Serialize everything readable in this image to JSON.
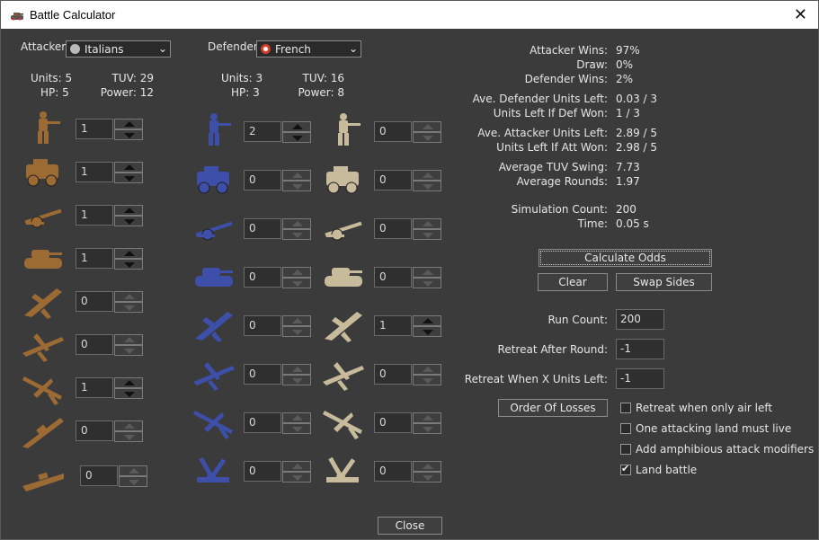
{
  "window": {
    "title": "Battle Calculator",
    "close_glyph": "✕"
  },
  "attacker": {
    "label": "Attacker:",
    "nation": "Italians",
    "flag_color": "#b9b9b9",
    "units_text": "Units: 5",
    "tuv_text": "TUV: 29",
    "hp_text": "HP: 5",
    "power_text": "Power: 12",
    "unit_color": "#9c6a33",
    "units": [
      {
        "type": "infantry-icon",
        "count": "1"
      },
      {
        "type": "armored-car-icon",
        "count": "1"
      },
      {
        "type": "artillery-icon",
        "count": "1"
      },
      {
        "type": "tank-icon",
        "count": "1"
      },
      {
        "type": "fighter-icon",
        "count": "0"
      },
      {
        "type": "tactical-bomber-icon",
        "count": "0"
      },
      {
        "type": "bomber-icon",
        "count": "1"
      },
      {
        "type": "battleship-icon",
        "count": "0"
      },
      {
        "type": "cruiser-icon",
        "count": "0"
      }
    ]
  },
  "defender": {
    "label": "Defender:",
    "nation": "French",
    "flag_color": "#d23a2a",
    "units_text": "Units: 3",
    "tuv_text": "TUV: 16",
    "hp_text": "HP: 3",
    "power_text": "Power: 8",
    "units_main": [
      {
        "type": "infantry-icon",
        "count": "2",
        "color": "#3d4fa8"
      },
      {
        "type": "armored-car-icon",
        "count": "0",
        "color": "#3d4fa8"
      },
      {
        "type": "artillery-icon",
        "count": "0",
        "color": "#3d4fa8"
      },
      {
        "type": "tank-icon",
        "count": "0",
        "color": "#3d4fa8"
      },
      {
        "type": "fighter-icon",
        "count": "0",
        "color": "#3d4fa8"
      },
      {
        "type": "tactical-bomber-icon",
        "count": "0",
        "color": "#3d4fa8"
      },
      {
        "type": "bomber-icon",
        "count": "0",
        "color": "#3d4fa8"
      },
      {
        "type": "anti-air-icon",
        "count": "0",
        "color": "#3d4fa8"
      }
    ],
    "units_alt": [
      {
        "type": "infantry-icon",
        "count": "0",
        "color": "#c8bb9c"
      },
      {
        "type": "armored-car-icon",
        "count": "0",
        "color": "#c8bb9c"
      },
      {
        "type": "artillery-icon",
        "count": "0",
        "color": "#c8bb9c"
      },
      {
        "type": "tank-icon",
        "count": "0",
        "color": "#c8bb9c"
      },
      {
        "type": "fighter-icon",
        "count": "1",
        "color": "#c8bb9c"
      },
      {
        "type": "tactical-bomber-icon",
        "count": "0",
        "color": "#c8bb9c"
      },
      {
        "type": "bomber-icon",
        "count": "0",
        "color": "#c8bb9c"
      },
      {
        "type": "anti-air-icon",
        "count": "0",
        "color": "#c8bb9c"
      }
    ]
  },
  "results": {
    "attacker_wins_label": "Attacker Wins:",
    "attacker_wins": "97%",
    "draw_label": "Draw:",
    "draw": "0%",
    "defender_wins_label": "Defender Wins:",
    "defender_wins": "2%",
    "ave_def_left_label": "Ave. Defender Units Left:",
    "ave_def_left": "0.03 / 3",
    "left_def_won_label": "Units Left If Def Won:",
    "left_def_won": "1 / 3",
    "ave_att_left_label": "Ave. Attacker Units Left:",
    "ave_att_left": "2.89 / 5",
    "left_att_won_label": "Units Left If Att Won:",
    "left_att_won": "2.98 / 5",
    "tuv_swing_label": "Average TUV Swing:",
    "tuv_swing": "7.73",
    "avg_rounds_label": "Average Rounds:",
    "avg_rounds": "1.97",
    "sim_count_label": "Simulation Count:",
    "sim_count": "200",
    "time_label": "Time:",
    "time": "0.05 s"
  },
  "buttons": {
    "calculate": "Calculate Odds",
    "clear": "Clear",
    "swap": "Swap Sides",
    "order_of_losses": "Order Of Losses",
    "close": "Close"
  },
  "settings": {
    "run_count_label": "Run Count:",
    "run_count": "200",
    "retreat_round_label": "Retreat After Round:",
    "retreat_round": "-1",
    "retreat_units_label": "Retreat When X Units Left:",
    "retreat_units": "-1",
    "opt_air_label": "Retreat when only air left",
    "opt_air": false,
    "opt_land_live_label": "One attacking land must live",
    "opt_land_live": false,
    "opt_amphib_label": "Add amphibious attack modifiers",
    "opt_amphib": false,
    "opt_land_battle_label": "Land battle",
    "opt_land_battle": true
  }
}
